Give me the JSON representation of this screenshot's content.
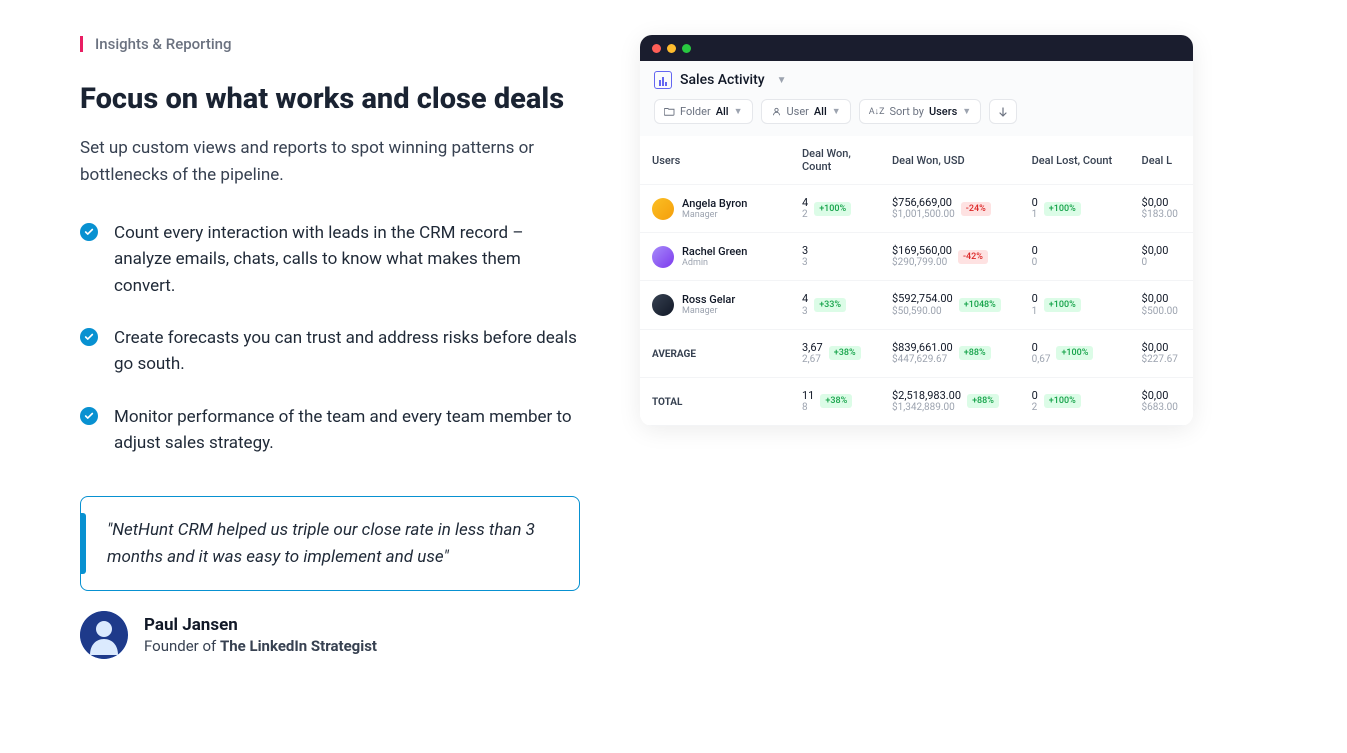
{
  "eyebrow": "Insights & Reporting",
  "headline": "Focus on what works and close deals",
  "subhead": "Set up custom views and reports to spot winning patterns or bottlenecks of the pipeline.",
  "bullets": [
    "Count every interaction with leads in the CRM record – analyze emails, chats, calls to know what makes them convert.",
    "Create forecasts you can trust and address risks before deals go south.",
    "Monitor performance of the team and every team member to adjust sales strategy."
  ],
  "quote": "\"NetHunt CRM helped us triple our close rate in less than 3 months and it was easy to implement and use\"",
  "author": {
    "name": "Paul Jansen",
    "role_prefix": "Founder of ",
    "role_company": "The LinkedIn Strategist"
  },
  "app": {
    "title": "Sales Activity",
    "filters": {
      "folder": {
        "label": "Folder",
        "value": "All"
      },
      "user": {
        "label": "User",
        "value": "All"
      },
      "sort": {
        "label": "Sort by",
        "value": "Users"
      }
    },
    "columns": [
      "Users",
      "Deal Won, Count",
      "Deal Won, USD",
      "Deal Lost, Count",
      "Deal L"
    ],
    "rows": [
      {
        "name": "Angela Byron",
        "role": "Manager",
        "won_count": {
          "main": "4",
          "sub": "2",
          "badge": "+100%",
          "badge_type": "pos"
        },
        "won_usd": {
          "main": "$756,669,00",
          "sub": "$1,001,500.00",
          "badge": "-24%",
          "badge_type": "neg"
        },
        "lost_count": {
          "main": "0",
          "sub": "1",
          "badge": "+100%",
          "badge_type": "pos"
        },
        "lost_usd": {
          "main": "$0,00",
          "sub": "$183.00"
        }
      },
      {
        "name": "Rachel Green",
        "role": "Admin",
        "won_count": {
          "main": "3",
          "sub": "3"
        },
        "won_usd": {
          "main": "$169,560,00",
          "sub": "$290,799.00",
          "badge": "-42%",
          "badge_type": "neg"
        },
        "lost_count": {
          "main": "0",
          "sub": "0"
        },
        "lost_usd": {
          "main": "$0,00",
          "sub": "0"
        }
      },
      {
        "name": "Ross Gelar",
        "role": "Manager",
        "won_count": {
          "main": "4",
          "sub": "3",
          "badge": "+33%",
          "badge_type": "pos"
        },
        "won_usd": {
          "main": "$592,754.00",
          "sub": "$50,590.00",
          "badge": "+1048%",
          "badge_type": "pos"
        },
        "lost_count": {
          "main": "0",
          "sub": "1",
          "badge": "+100%",
          "badge_type": "pos"
        },
        "lost_usd": {
          "main": "$0,00",
          "sub": "$500.00"
        }
      }
    ],
    "summary": [
      {
        "label": "AVERAGE",
        "won_count": {
          "main": "3,67",
          "sub": "2,67",
          "badge": "+38%",
          "badge_type": "pos"
        },
        "won_usd": {
          "main": "$839,661.00",
          "sub": "$447,629.67",
          "badge": "+88%",
          "badge_type": "pos"
        },
        "lost_count": {
          "main": "0",
          "sub": "0,67",
          "badge": "+100%",
          "badge_type": "pos"
        },
        "lost_usd": {
          "main": "$0,00",
          "sub": "$227.67"
        }
      },
      {
        "label": "TOTAL",
        "won_count": {
          "main": "11",
          "sub": "8",
          "badge": "+38%",
          "badge_type": "pos"
        },
        "won_usd": {
          "main": "$2,518,983.00",
          "sub": "$1,342,889.00",
          "badge": "+88%",
          "badge_type": "pos"
        },
        "lost_count": {
          "main": "0",
          "sub": "2",
          "badge": "+100%",
          "badge_type": "pos"
        },
        "lost_usd": {
          "main": "$0,00",
          "sub": "$683.00"
        }
      }
    ]
  }
}
